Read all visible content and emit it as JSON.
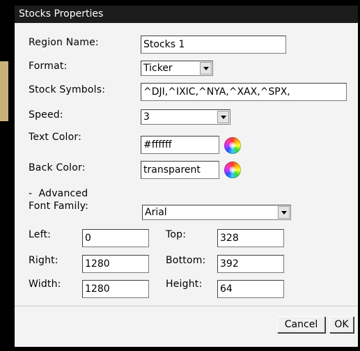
{
  "dialog": {
    "title": "Stocks Properties",
    "region_name": {
      "label": "Region Name:",
      "value": "Stocks 1"
    },
    "format": {
      "label": "Format:",
      "value": "Ticker"
    },
    "stock_symbols": {
      "label": "Stock Symbols:",
      "value": "^DJI,^IXIC,^NYA,^XAX,^SPX,"
    },
    "speed": {
      "label": "Speed:",
      "value": "3"
    },
    "text_color": {
      "label": "Text Color:",
      "value": "#ffffff"
    },
    "back_color": {
      "label": "Back Color:",
      "value": "transparent"
    },
    "advanced": {
      "toggle": "-",
      "label": "Advanced"
    },
    "font_family": {
      "label": "Font Family:",
      "value": "Arial"
    },
    "left": {
      "label": "Left:",
      "value": "0"
    },
    "top": {
      "label": "Top:",
      "value": "328"
    },
    "right": {
      "label": "Right:",
      "value": "1280"
    },
    "bottom": {
      "label": "Bottom:",
      "value": "392"
    },
    "width": {
      "label": "Width:",
      "value": "1280"
    },
    "height": {
      "label": "Height:",
      "value": "64"
    },
    "buttons": {
      "cancel": "Cancel",
      "ok": "OK"
    }
  },
  "colors": {
    "titlebar_bg": "#1c1c1c",
    "dialog_bg": "#f3f3f3",
    "backdrop": "#000000"
  },
  "icons": {
    "color_picker": "color-wheel-icon",
    "dropdown": "chevron-down-icon"
  }
}
